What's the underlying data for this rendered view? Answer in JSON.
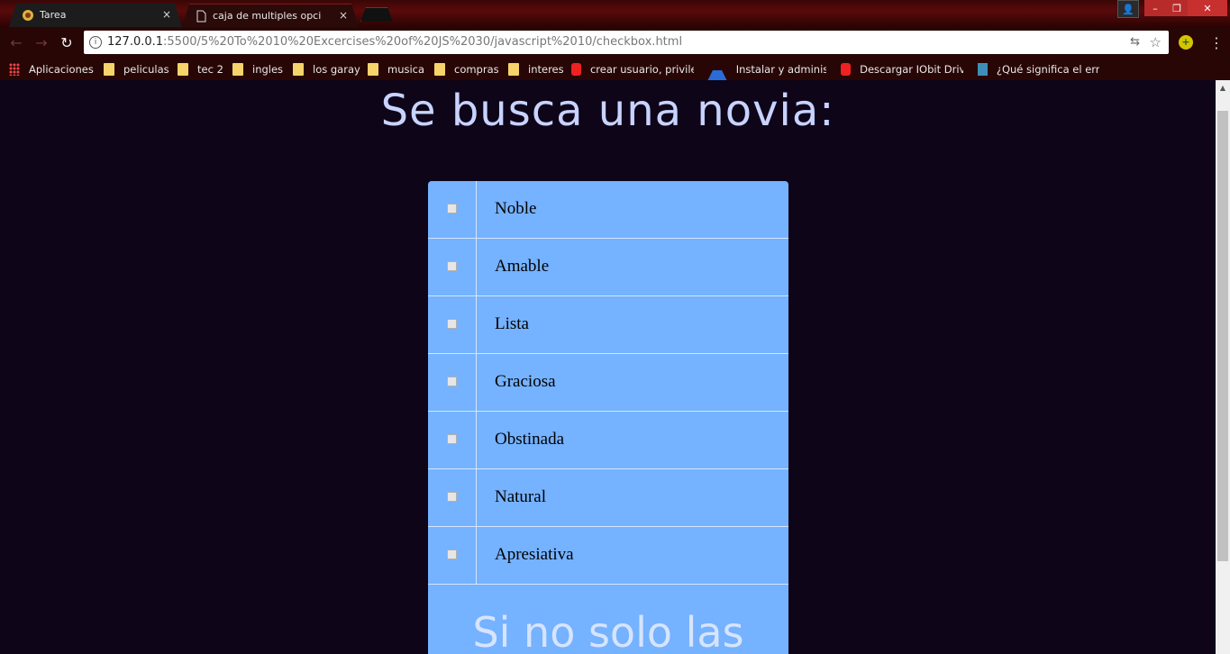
{
  "browser": {
    "tabs": [
      {
        "title": "Tarea",
        "close": "×"
      },
      {
        "title": "caja de multiples opcion",
        "close": "×"
      }
    ],
    "window_controls": {
      "minimize": "–",
      "maximize": "❐",
      "close": "✕",
      "user": "👤"
    },
    "nav": {
      "back": "←",
      "forward": "→",
      "reload": "↻"
    },
    "url": {
      "host": "127.0.0.1",
      "path": ":5500/5%20To%2010%20Excercises%20of%20JS%2030/javascript%2010/checkbox.html"
    },
    "bookmarks": [
      {
        "label": "Aplicaciones",
        "icon": "apps-icon"
      },
      {
        "label": "peliculas",
        "icon": "folder-icon"
      },
      {
        "label": "tec 2",
        "icon": "folder-icon"
      },
      {
        "label": "ingles",
        "icon": "folder-icon"
      },
      {
        "label": "los garay",
        "icon": "folder-icon"
      },
      {
        "label": "musica",
        "icon": "folder-icon"
      },
      {
        "label": "compras",
        "icon": "folder-icon"
      },
      {
        "label": "interes",
        "icon": "folder-icon"
      },
      {
        "label": "crear usuario, privileg",
        "icon": "youtube-icon"
      },
      {
        "label": "Instalar y administrar",
        "icon": "azure-icon"
      },
      {
        "label": "Descargar IObit Drive",
        "icon": "youtube-icon"
      },
      {
        "label": "¿Qué significa el error",
        "icon": "document-icon"
      }
    ]
  },
  "page": {
    "title": "Se busca una novia:",
    "options": [
      "Noble",
      "Amable",
      "Lista",
      "Graciosa",
      "Obstinada",
      "Natural",
      "Apresiativa"
    ],
    "footer": "Si no solo las"
  },
  "colors": {
    "background": "#0e0519",
    "panel": "#75b2ff",
    "title": "#c8d3ff"
  }
}
